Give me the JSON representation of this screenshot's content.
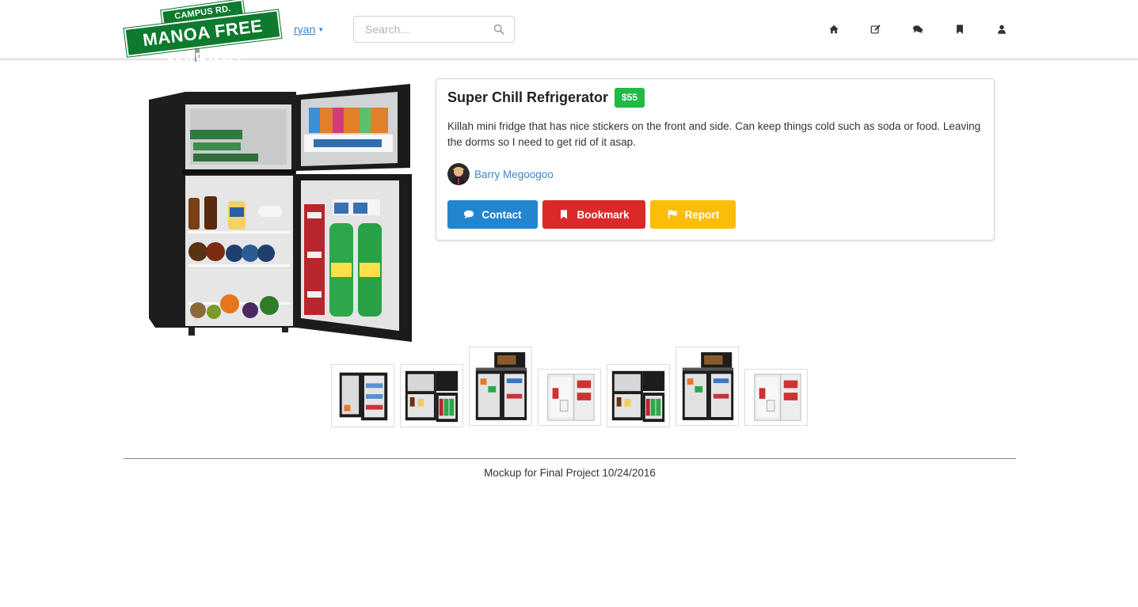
{
  "header": {
    "logo": {
      "line1": "CAMPUS RD. 96813 ▸",
      "line2": "MANOA FREE MARKET"
    },
    "user_menu_label": "ryan",
    "search": {
      "placeholder": "Search..."
    },
    "nav_icons": [
      "home-icon",
      "edit-icon",
      "comments-icon",
      "bookmark-icon",
      "user-icon"
    ]
  },
  "listing": {
    "title": "Super Chill Refrigerator",
    "price": "$55",
    "description": "Killah mini fridge that has nice stickers on the front and side. Can keep things cold such as soda or food. Leaving the dorms so I need to get rid of it asap.",
    "seller_name": "Barry Megoogoo",
    "actions": {
      "contact": "Contact",
      "bookmark": "Bookmark",
      "report": "Report"
    }
  },
  "thumbnails": [
    {
      "kind": "black-fridge-open"
    },
    {
      "kind": "black-fridge-stocked"
    },
    {
      "kind": "fridge-microwave-black"
    },
    {
      "kind": "white-fridge"
    },
    {
      "kind": "black-fridge-stocked"
    },
    {
      "kind": "fridge-microwave-black"
    },
    {
      "kind": "white-fridge"
    }
  ],
  "footer": {
    "text": "Mockup for Final Project 10/24/2016"
  },
  "colors": {
    "brand_green": "#0d7a2e",
    "price_badge": "#21ba45",
    "contact": "#2185d0",
    "bookmark": "#db2828",
    "report": "#fbbd08",
    "link": "#4183c4"
  }
}
